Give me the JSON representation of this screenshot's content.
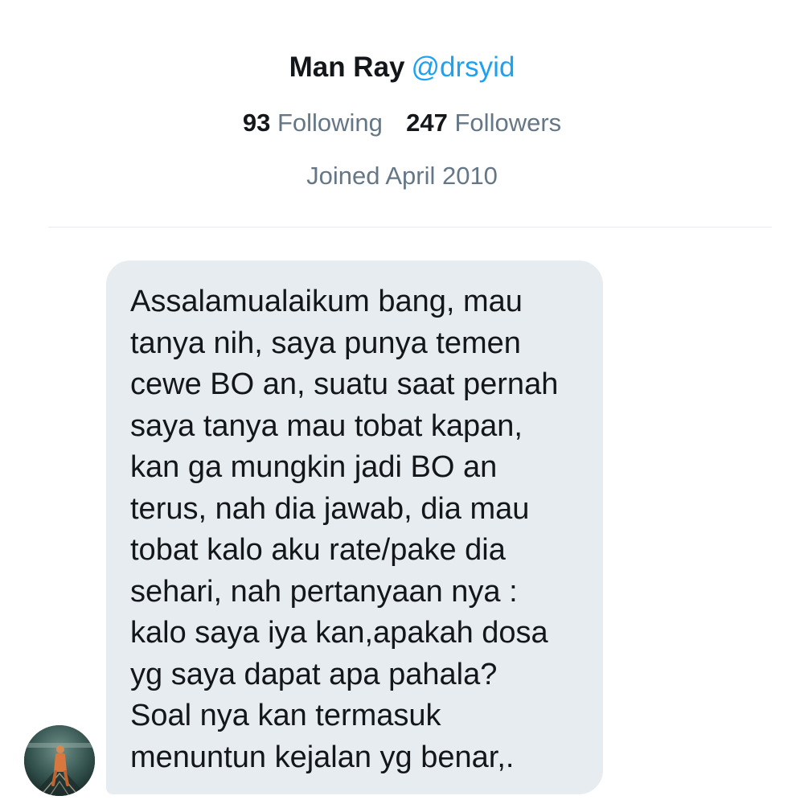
{
  "profile": {
    "display_name": "Man Ray",
    "handle": "@drsyid",
    "following_count": "93",
    "following_label": "Following",
    "followers_count": "247",
    "followers_label": "Followers",
    "joined_text": "Joined April 2010"
  },
  "message": {
    "text": "Assalamualaikum bang, mau\ntanya nih, saya punya temen\ncewe BO an, suatu saat pernah\nsaya tanya mau tobat kapan,\nkan ga mungkin jadi BO an\nterus, nah dia jawab, dia mau\ntobat kalo aku rate/pake dia\nsehari, nah pertanyaan nya :\nkalo saya iya kan,apakah dosa\nyg saya dapat apa pahala?\nSoal nya kan termasuk\nmenuntun kejalan yg benar,."
  },
  "colors": {
    "handle": "#1da1f2",
    "secondary_text": "#657786",
    "primary_text": "#14171a",
    "bubble": "#e6ecf0"
  },
  "icons": {
    "avatar": "sender-avatar"
  }
}
